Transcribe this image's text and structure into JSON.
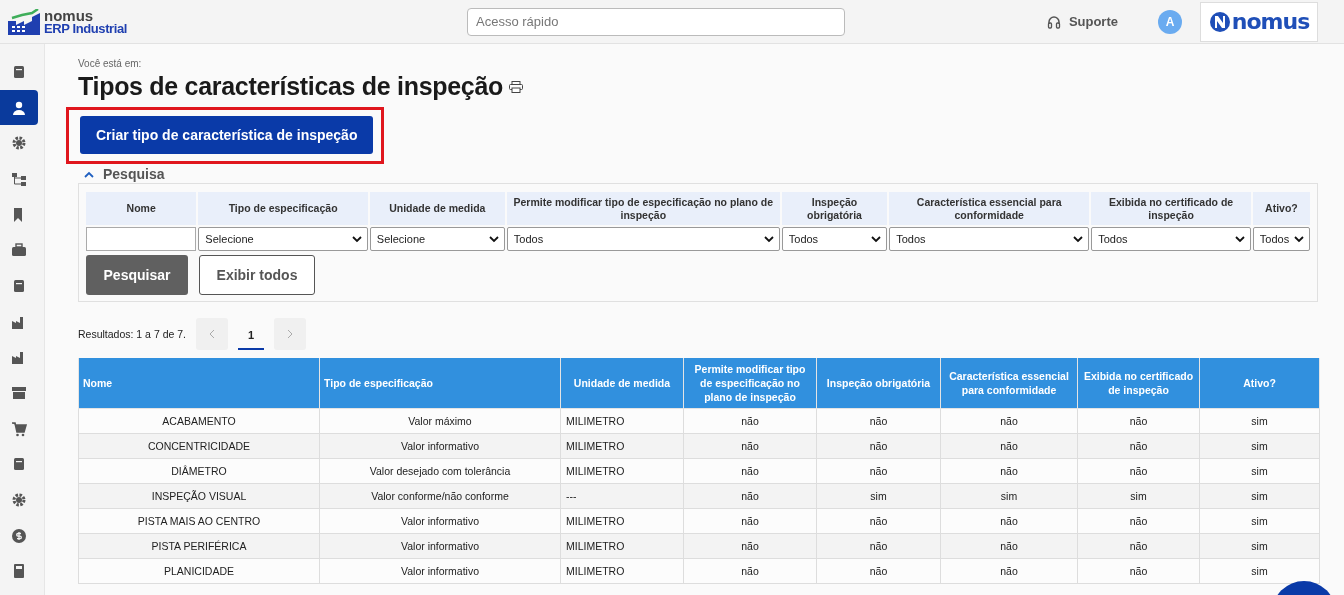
{
  "header": {
    "logo_word": "nomus",
    "logo_sub": "ERP Industrial",
    "search": {
      "placeholder": "Acesso rápido"
    },
    "support": "Suporte",
    "avatar": "A",
    "brand": "nomus"
  },
  "sidebar": {
    "items": [
      {
        "selected": false
      },
      {
        "selected": true
      },
      {
        "selected": false
      },
      {
        "selected": false
      },
      {
        "selected": false
      },
      {
        "selected": false
      },
      {
        "selected": false
      },
      {
        "selected": false
      },
      {
        "selected": false
      },
      {
        "selected": false
      },
      {
        "selected": false
      },
      {
        "selected": false
      },
      {
        "selected": false
      },
      {
        "selected": false
      },
      {
        "selected": false
      }
    ]
  },
  "breadcrumb": "Você está em:",
  "title": "Tipos de características de inspeção",
  "create_button": {
    "label": "Criar tipo de característica de inspeção",
    "highlighted": true
  },
  "search_panel": {
    "title": "Pesquisa",
    "expanded": true,
    "filters": [
      {
        "label": "Nome",
        "kind": "input"
      },
      {
        "label": "Tipo de especificação",
        "kind": "select",
        "value": "Selecione"
      },
      {
        "label": "Unidade de medida",
        "kind": "select",
        "value": "Selecione"
      },
      {
        "label": "Permite modificar tipo de especificação no plano de inspeção",
        "kind": "select",
        "value": "Todos"
      },
      {
        "label": "Inspeção obrigatória",
        "kind": "select",
        "value": "Todos"
      },
      {
        "label": "Característica essencial para conformidade",
        "kind": "select",
        "value": "Todos"
      },
      {
        "label": "Exibida no certificado de inspeção",
        "kind": "select",
        "value": "Todos"
      },
      {
        "label": "Ativo?",
        "kind": "select",
        "value": "Todos"
      }
    ],
    "buttons": [
      {
        "label": "Pesquisar",
        "kind": "primary"
      },
      {
        "label": "Exibir todos",
        "kind": "secondary"
      }
    ]
  },
  "results": {
    "summary": "Resultados: 1 a 7 de 7.",
    "pages": [
      {
        "label": "1",
        "selected": true
      }
    ]
  },
  "table": {
    "columns": [
      "Nome",
      "Tipo de especificação",
      "Unidade de medida",
      "Permite modificar tipo de especificação no plano de inspeção",
      "Inspeção obrigatória",
      "Característica essencial para conformidade",
      "Exibida no certificado de inspeção",
      "Ativo?"
    ],
    "rows": [
      [
        "ACABAMENTO",
        "Valor máximo",
        "MILIMETRO",
        "não",
        "não",
        "não",
        "não",
        "sim"
      ],
      [
        "CONCENTRICIDADE",
        "Valor informativo",
        "MILIMETRO",
        "não",
        "não",
        "não",
        "não",
        "sim"
      ],
      [
        "DIÂMETRO",
        "Valor desejado com tolerância",
        "MILIMETRO",
        "não",
        "não",
        "não",
        "não",
        "sim"
      ],
      [
        "INSPEÇÃO VISUAL",
        "Valor conforme/não conforme",
        "---",
        "não",
        "sim",
        "sim",
        "sim",
        "sim"
      ],
      [
        "PISTA MAIS AO CENTRO",
        "Valor informativo",
        "MILIMETRO",
        "não",
        "não",
        "não",
        "não",
        "sim"
      ],
      [
        "PISTA PERIFÉRICA",
        "Valor informativo",
        "MILIMETRO",
        "não",
        "não",
        "não",
        "não",
        "sim"
      ],
      [
        "PLANICIDADE",
        "Valor informativo",
        "MILIMETRO",
        "não",
        "não",
        "não",
        "não",
        "sim"
      ]
    ]
  }
}
